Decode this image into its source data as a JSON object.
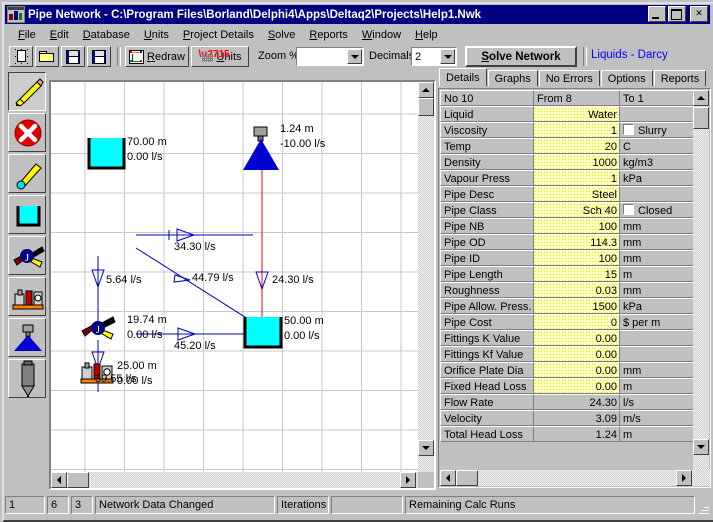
{
  "window": {
    "title": "Pipe Network  - C:\\Program Files\\Borland\\Delphi4\\Apps\\Deltaq2\\Projects\\Help1.Nwk",
    "minimize_label": "_",
    "maximize_label": "□",
    "close_label": "✕"
  },
  "menu": {
    "items": [
      {
        "label": "File"
      },
      {
        "label": "Edit"
      },
      {
        "label": "Database"
      },
      {
        "label": "Units"
      },
      {
        "label": "Project Details"
      },
      {
        "label": "Solve"
      },
      {
        "label": "Reports"
      },
      {
        "label": "Window"
      },
      {
        "label": "Help"
      }
    ]
  },
  "toolbar": {
    "new_tip": "New",
    "open_tip": "Open",
    "save_tip": "Save",
    "saveas_tip": "Save As",
    "redraw_label": "Redraw",
    "units_label": "Units",
    "zoom_label": "Zoom %",
    "zoom_value": "",
    "decimals_label": "Decimals",
    "decimals_value": "2",
    "solve_label": "Solve Network",
    "method_label": "Liquids - Darcy"
  },
  "palette": {
    "items": [
      {
        "name": "pencil-tool",
        "tip": "Draw / Edit"
      },
      {
        "name": "delete-tool",
        "tip": "Delete"
      },
      {
        "name": "pipe-tool",
        "tip": "Pipe"
      },
      {
        "name": "tank-tool",
        "tip": "Tank"
      },
      {
        "name": "valve-tool",
        "tip": "Valve"
      },
      {
        "name": "pump-tool",
        "tip": "Pump"
      },
      {
        "name": "sprinkler-tool",
        "tip": "Sprinkler"
      },
      {
        "name": "vessel-tool",
        "tip": "Vessel"
      }
    ]
  },
  "canvas": {
    "nodes": [
      {
        "id": "tank-1",
        "type": "tank",
        "head": "70.00 m",
        "flow": "0.00 l/s"
      },
      {
        "id": "sprinkler-1",
        "type": "sprinkler",
        "head": "1.24 m",
        "flow": "-10.00 l/s"
      },
      {
        "id": "valve-1",
        "type": "valve",
        "head": "19.74 m",
        "flow": "0.00 l/s"
      },
      {
        "id": "tank-2",
        "type": "tank",
        "head": "50.00 m",
        "flow": "0.00 l/s"
      },
      {
        "id": "pump-1",
        "type": "pump",
        "head": "25.00 m",
        "flow": "0.00 l/s"
      }
    ],
    "pipe_flows": [
      {
        "id": "flow-top",
        "label": "34.30 l/s"
      },
      {
        "id": "flow-diagonal",
        "label": "44.79 l/s"
      },
      {
        "id": "flow-left",
        "label": "5.64 l/s"
      },
      {
        "id": "flow-mid",
        "label": "45.20 l/s"
      },
      {
        "id": "flow-down",
        "label": "39.55 l/s"
      },
      {
        "id": "flow-right",
        "label": "24.30 l/s"
      }
    ]
  },
  "tabs": [
    {
      "label": "Details",
      "active": true
    },
    {
      "label": "Graphs",
      "active": false
    },
    {
      "label": "No Errors",
      "active": false
    },
    {
      "label": "Options",
      "active": false
    },
    {
      "label": "Reports",
      "active": false
    }
  ],
  "details": {
    "header": {
      "no": "No 10",
      "from": "From 8",
      "to": "To 1"
    },
    "rows": [
      {
        "label": "Liquid",
        "value": "Water",
        "unit": "",
        "editable": true,
        "align": "right",
        "checkbox": false
      },
      {
        "label": "Viscosity",
        "value": "1",
        "unit": "Slurry",
        "editable": true,
        "align": "right",
        "checkbox": true
      },
      {
        "label": "Temp",
        "value": "20",
        "unit": "C",
        "editable": true,
        "align": "right",
        "checkbox": false
      },
      {
        "label": "Density",
        "value": "1000",
        "unit": "kg/m3",
        "editable": true,
        "align": "right",
        "checkbox": false
      },
      {
        "label": "Vapour Press",
        "value": "1",
        "unit": "kPa",
        "editable": true,
        "align": "right",
        "checkbox": false
      },
      {
        "label": "Pipe Desc",
        "value": "Steel",
        "unit": "",
        "editable": true,
        "align": "right",
        "checkbox": false
      },
      {
        "label": "Pipe Class",
        "value": "Sch 40",
        "unit": "Closed",
        "editable": true,
        "align": "right",
        "checkbox": true
      },
      {
        "label": "Pipe NB",
        "value": "100",
        "unit": "mm",
        "editable": true,
        "align": "right",
        "checkbox": false
      },
      {
        "label": "Pipe OD",
        "value": "114.3",
        "unit": "mm",
        "editable": true,
        "align": "right",
        "checkbox": false
      },
      {
        "label": "Pipe ID",
        "value": "100",
        "unit": "mm",
        "editable": true,
        "align": "right",
        "checkbox": false
      },
      {
        "label": "Pipe Length",
        "value": "15",
        "unit": "m",
        "editable": true,
        "align": "right",
        "checkbox": false
      },
      {
        "label": "Roughness",
        "value": "0.03",
        "unit": "mm",
        "editable": true,
        "align": "right",
        "checkbox": false
      },
      {
        "label": "Pipe Allow. Press.",
        "value": "1500",
        "unit": "kPa",
        "editable": true,
        "align": "right",
        "checkbox": false
      },
      {
        "label": "Pipe Cost",
        "value": "0",
        "unit": "$ per m",
        "editable": true,
        "align": "right",
        "checkbox": false
      },
      {
        "label": "Fittings K Value",
        "value": "0.00",
        "unit": "",
        "editable": true,
        "align": "right",
        "checkbox": false
      },
      {
        "label": "Fittings Kf Value",
        "value": "0.00",
        "unit": "",
        "editable": true,
        "align": "right",
        "checkbox": false
      },
      {
        "label": "Orifice Plate Dia",
        "value": "0.00",
        "unit": "mm",
        "editable": true,
        "align": "right",
        "checkbox": false
      },
      {
        "label": "Fixed Head Loss",
        "value": "0.00",
        "unit": "m",
        "editable": true,
        "align": "right",
        "checkbox": false
      },
      {
        "label": "Flow Rate",
        "value": "24.30",
        "unit": "l/s",
        "editable": false,
        "align": "right",
        "checkbox": false
      },
      {
        "label": "Velocity",
        "value": "3.09",
        "unit": "m/s",
        "editable": false,
        "align": "right",
        "checkbox": false
      },
      {
        "label": "Total Head Loss",
        "value": "1.24",
        "unit": "m",
        "editable": false,
        "align": "right",
        "checkbox": false
      }
    ]
  },
  "statusbar": {
    "panels": [
      {
        "label": "1"
      },
      {
        "label": "6"
      },
      {
        "label": "3"
      },
      {
        "label": "Network Data Changed"
      },
      {
        "label": "Iterations"
      },
      {
        "label": ""
      },
      {
        "label": "Remaining Calc Runs"
      }
    ]
  },
  "colors": {
    "titlebar": "#000080",
    "face": "#c0c0c0",
    "accent_blue": "#0000ff",
    "tank_fill": "#00ffff",
    "pipe_red": "#ff0000",
    "edit_yellow": "#ffffc0"
  }
}
